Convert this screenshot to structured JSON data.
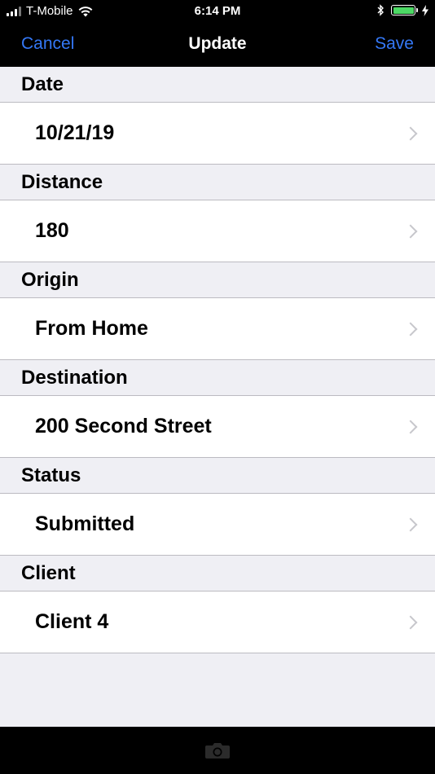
{
  "status_bar": {
    "carrier": "T-Mobile",
    "time": "6:14 PM",
    "battery_color": "#4cd964"
  },
  "nav": {
    "cancel_label": "Cancel",
    "title": "Update",
    "save_label": "Save",
    "accent_color": "#3478f6"
  },
  "form": {
    "date": {
      "label": "Date",
      "value": "10/21/19"
    },
    "distance": {
      "label": "Distance",
      "value": "180"
    },
    "origin": {
      "label": "Origin",
      "value": "From Home"
    },
    "destination": {
      "label": "Destination",
      "value": "200 Second Street"
    },
    "status": {
      "label": "Status",
      "value": "Submitted"
    },
    "client": {
      "label": "Client",
      "value": "Client 4"
    }
  },
  "toolbar": {
    "camera_icon": "camera-icon"
  }
}
